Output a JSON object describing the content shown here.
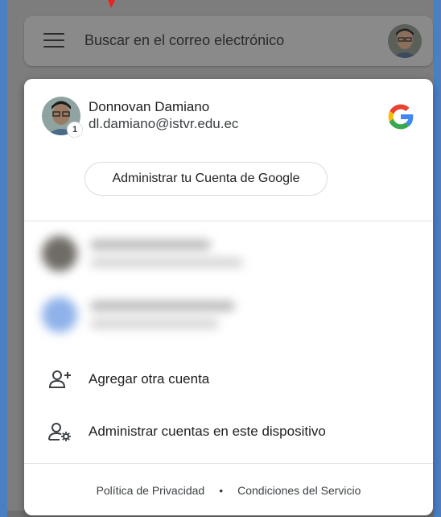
{
  "search": {
    "placeholder": "Buscar en el correo electrónico"
  },
  "account": {
    "name": "Donnovan Damiano",
    "email": "dl.damiano@istvr.edu.ec",
    "badge_count": "1",
    "manage_label": "Administrar tu Cuenta de Google"
  },
  "actions": {
    "add_account": "Agregar otra cuenta",
    "manage_accounts": "Administrar cuentas en este dispositivo"
  },
  "footer": {
    "privacy": "Política de Privacidad",
    "separator": "•",
    "terms": "Condiciones del Servicio"
  },
  "colors": {
    "accent_blue": "#4285F4",
    "accent_red": "#EA4335",
    "accent_yellow": "#FBBC05",
    "accent_green": "#34A853"
  },
  "icons": {
    "menu": "menu-icon",
    "google_logo": "google-g-icon",
    "add_person": "person-add-icon",
    "manage_accounts": "manage-accounts-icon"
  }
}
